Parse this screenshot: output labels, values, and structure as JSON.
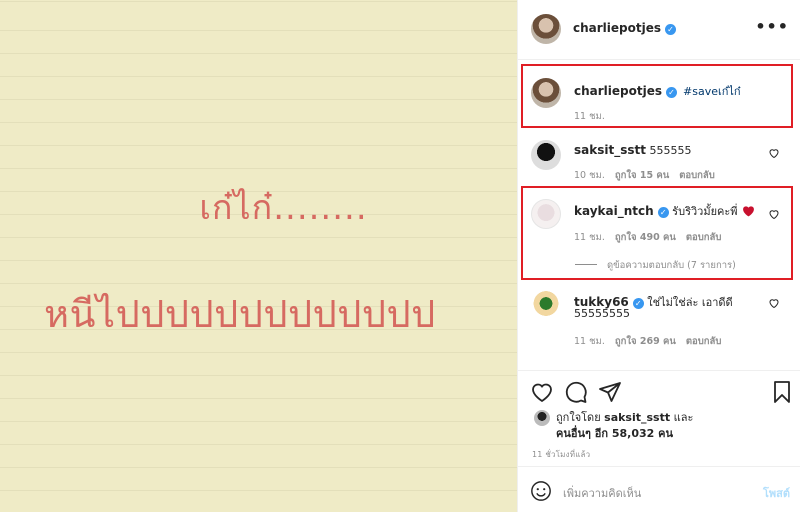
{
  "image": {
    "line1": "เก๋ไก๋........",
    "line2": "หนีไปปปปปปปปปปปปป"
  },
  "header": {
    "username": "charliepotjes",
    "more_icon": "more-horizontal-icon"
  },
  "caption": {
    "username": "charliepotjes",
    "text": "#saveเก๋ไก๋",
    "time": "11 ชม."
  },
  "comments": [
    {
      "username": "saksit_sstt",
      "text": "555555",
      "time": "10 ชม.",
      "likes": "ถูกใจ 15 คน",
      "reply": "ตอบกลับ"
    },
    {
      "username": "kaykai_ntch",
      "text": "รับริวิวมั้ยคะพี่",
      "time": "11 ชม.",
      "likes": "ถูกใจ 490 คน",
      "reply": "ตอบกลับ",
      "view_replies": "ดูข้อความตอบกลับ (7 รายการ)"
    },
    {
      "username": "tukky66",
      "text": "ใช่ไม่ใช่ล่ะ เอาดีดี",
      "text2": "55555555",
      "time": "11 ชม.",
      "likes": "ถูกใจ 269 คน",
      "reply": "ตอบกลับ"
    }
  ],
  "liked_by": {
    "prefix": "ถูกใจโดย",
    "user": "saksit_sstt",
    "and": "และ",
    "others": "คนอื่นๆ อีก 58,032 คน"
  },
  "time_ago": "11 ชั่วโมงที่แล้ว",
  "add_comment": {
    "placeholder": "เพิ่มความคิดเห็น",
    "post_label": "โพสต์"
  },
  "colors": {
    "highlight_border": "#e01e25",
    "verified": "#3897f0",
    "image_bg": "#efebc6",
    "image_text": "#d66a61"
  }
}
